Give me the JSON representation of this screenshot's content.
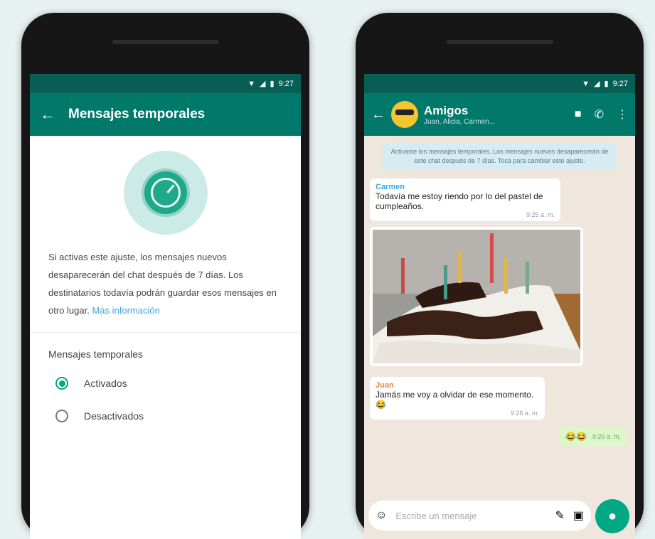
{
  "colors": {
    "status_bar": "#075e54",
    "app_bar": "#00796b",
    "accent": "#00a884",
    "chat_bg": "#efe7dd",
    "outgoing_bubble": "#dcf8c6"
  },
  "left": {
    "status": {
      "time": "9:27",
      "icons": [
        "wifi-icon",
        "signal-icon",
        "battery-icon"
      ]
    },
    "title": "Mensajes temporales",
    "description_main": "Si activas este ajuste, los mensajes nuevos desaparecerán del chat después de 7 días. Los destinatarios todavía podrán guardar esos mensajes en otro lugar.",
    "learn_more": "Más información",
    "section_title": "Mensajes temporales",
    "options": [
      {
        "label": "Activados",
        "selected": true
      },
      {
        "label": "Desactivados",
        "selected": false
      }
    ]
  },
  "right": {
    "status": {
      "time": "9:27",
      "icons": [
        "wifi-icon",
        "signal-icon",
        "battery-icon"
      ]
    },
    "chat_name": "Amigos",
    "members": "Juan, Alicia, Carmen...",
    "system_message": "Activaste los mensajes temporales. Los mensajes nuevos desaparecerán de este chat después de 7 días. Toca para cambiar este ajuste.",
    "messages": [
      {
        "sender": "Carmen",
        "sender_color": "#35a8e0",
        "text": "Todavía me estoy riendo por lo del pastel de cumpleaños.",
        "time": "9:25 a. m."
      },
      {
        "sender": "Juan",
        "sender_color": "#e8833a",
        "text": "Jamás me voy a olvidar de ese momento. 😂",
        "time": "9:26 a. m."
      }
    ],
    "sent": {
      "text": "😂😂",
      "time": "9:26 a. m."
    },
    "composer_placeholder": "Escribe un mensaje"
  }
}
